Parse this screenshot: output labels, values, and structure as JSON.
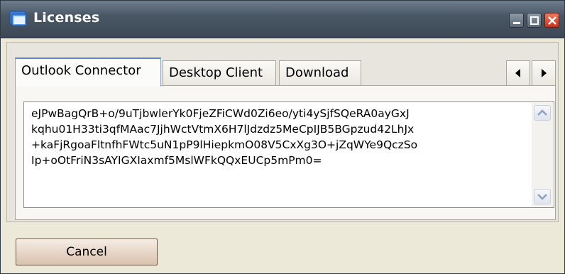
{
  "window": {
    "title": "Licenses",
    "icon": "window-app-icon",
    "controls": [
      "minimize-icon",
      "maximize-icon",
      "close-icon"
    ]
  },
  "tabs": [
    {
      "label": "Outlook Connector",
      "active": true
    },
    {
      "label": "Desktop Client",
      "active": false
    },
    {
      "label": "Download",
      "active": false
    }
  ],
  "tab_scroll": {
    "left_icon": "chevron-left-icon",
    "right_icon": "chevron-right-icon"
  },
  "license": {
    "key": "eJPwBagQrB+o/9uTjbwlerYk0FjeZFiCWd0Zi6eo/yti4ySjfSQeRA0ayGxJ\nkqhu01H33ti3qfMAac7JjhWctVtmX6H7lJdzdz5MeCpIJB5BGpzud42LhJx\n+kaFjRgoaFltnfhFWtc5uN1pP9lHiepkmO08V5CxXg3O+jZqWYe9QczSo\nIp+oOtFriN3sAYIGXIaxmf5MslWFkQQxEUCp5mPm0="
  },
  "buttons": {
    "cancel": "Cancel"
  },
  "colors": {
    "titlebar": "#4a5866",
    "active_tab_border": "#5c8ac8",
    "close_button": "#c8321c"
  }
}
